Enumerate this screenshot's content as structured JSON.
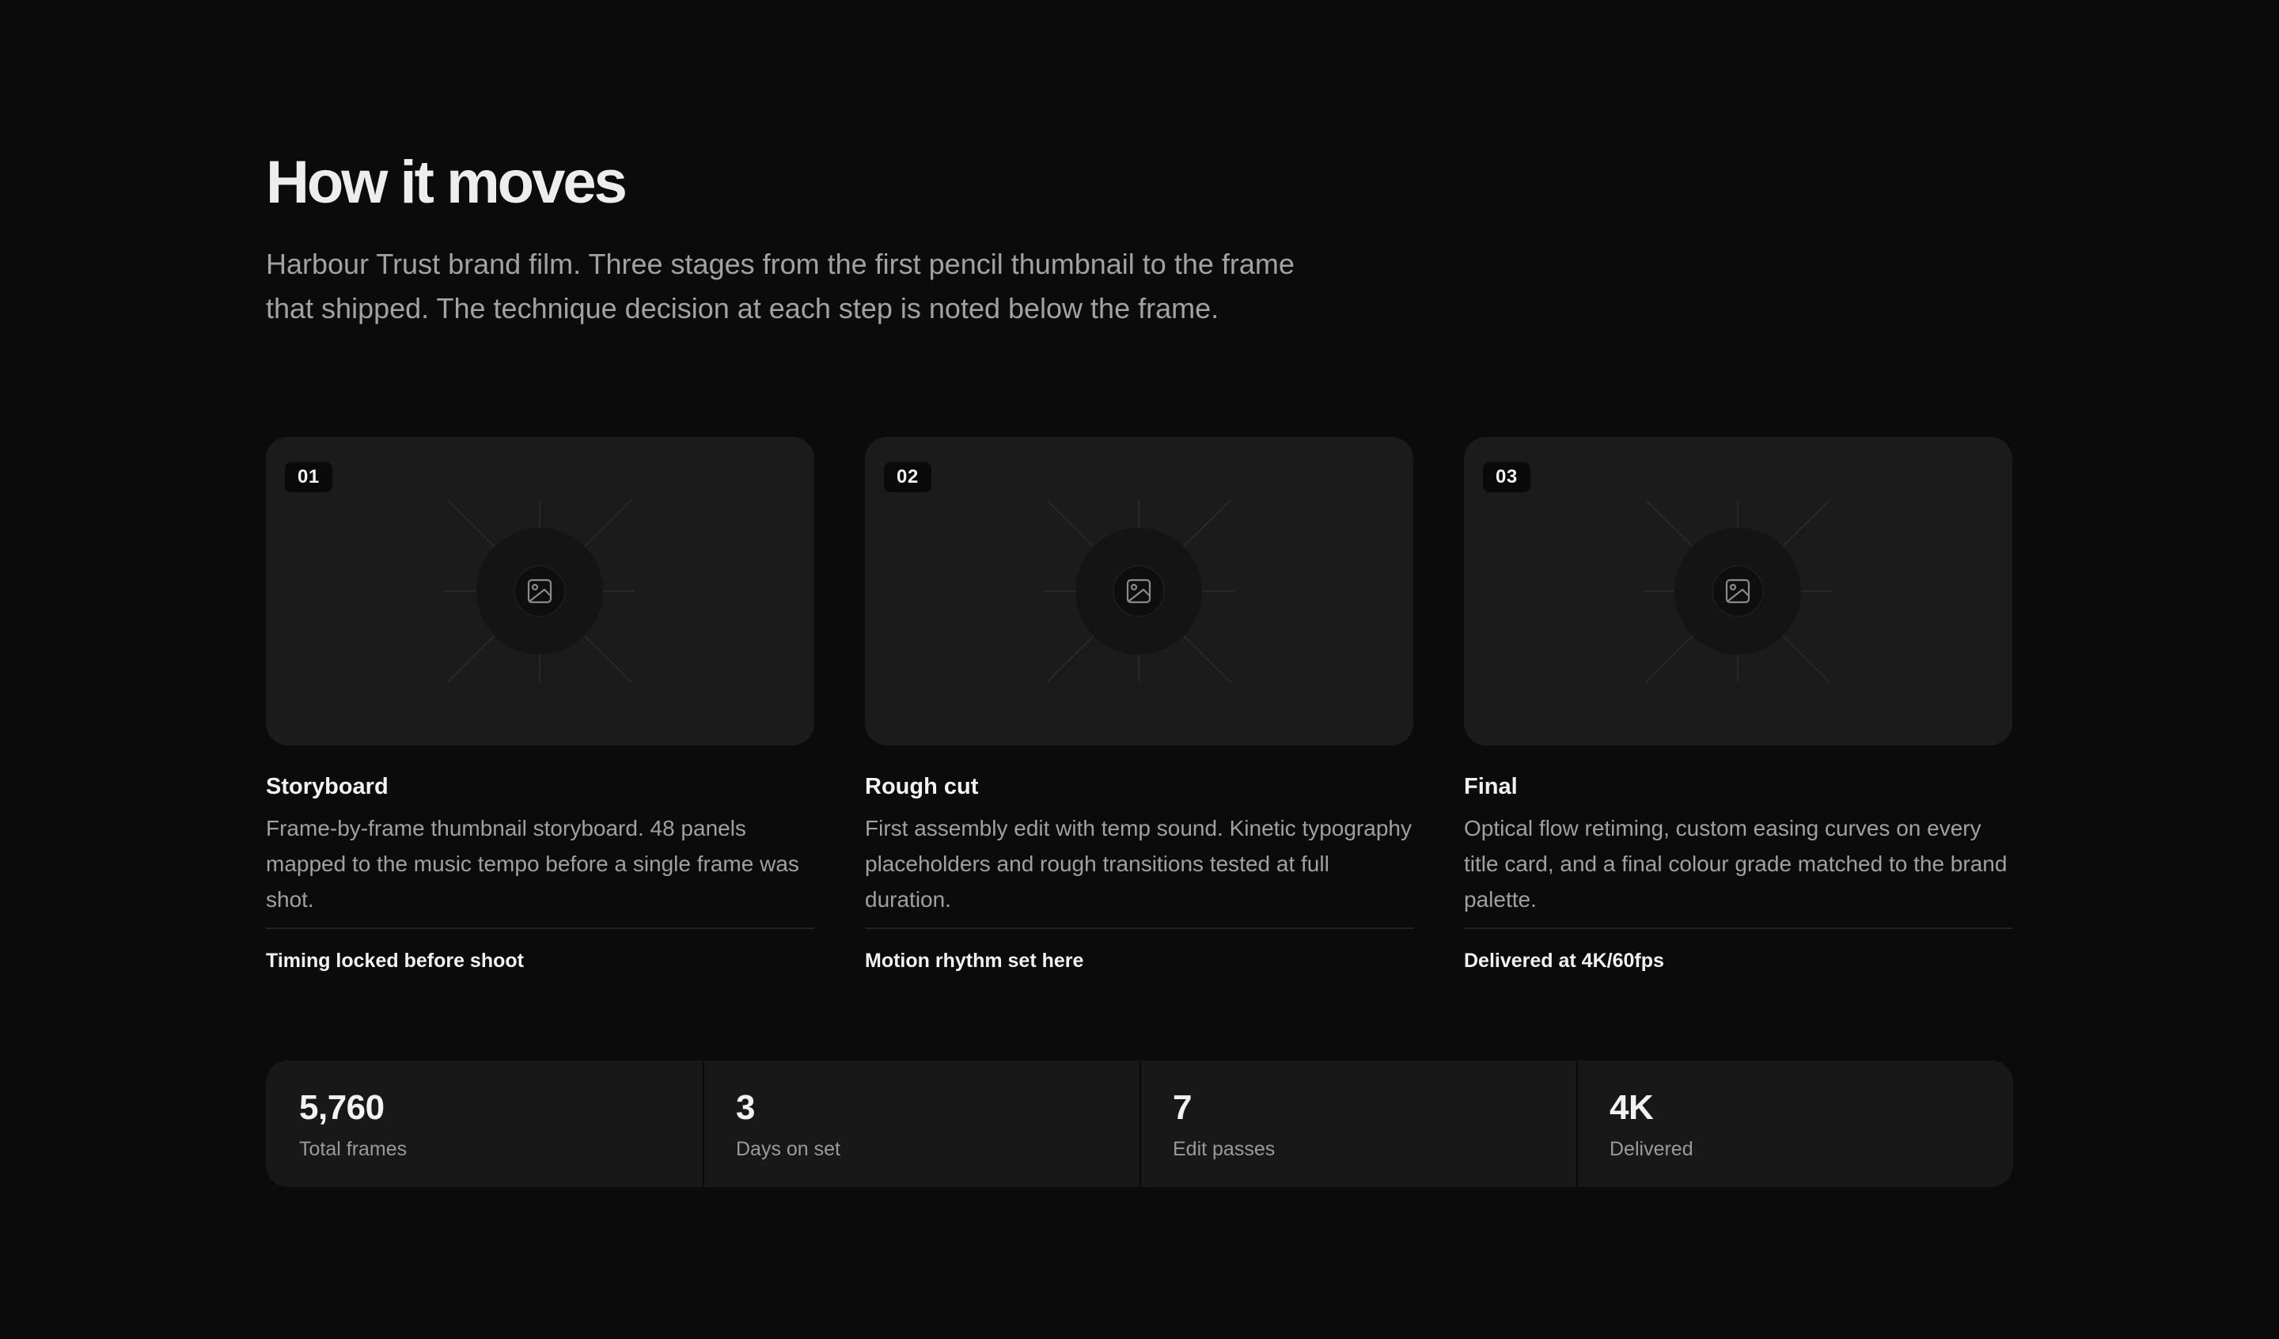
{
  "header": {
    "title": "How it moves",
    "intro": "Harbour Trust brand film. Three stages from the first pencil thumbnail to the frame that shipped. The technique decision at each step is noted below the frame."
  },
  "stages": [
    {
      "number": "01",
      "title": "Storyboard",
      "description": "Frame-by-frame thumbnail storyboard. 48 panels mapped to the music tempo before a single frame was shot.",
      "note": "Timing locked before shoot",
      "icon": "image-icon"
    },
    {
      "number": "02",
      "title": "Rough cut",
      "description": "First assembly edit with temp sound. Kinetic typography placeholders and rough transitions tested at full duration.",
      "note": "Motion rhythm set here",
      "icon": "image-icon"
    },
    {
      "number": "03",
      "title": "Final",
      "description": "Optical flow retiming, custom easing curves on every title card, and a final colour grade matched to the brand palette.",
      "note": "Delivered at 4K/60fps",
      "icon": "image-icon"
    }
  ],
  "stats": [
    {
      "value": "5,760",
      "label": "Total frames"
    },
    {
      "value": "3",
      "label": "Days on set"
    },
    {
      "value": "7",
      "label": "Edit passes"
    },
    {
      "value": "4K",
      "label": "Delivered"
    }
  ],
  "colors": {
    "background": "#0b0b0b",
    "card": "#1b1b1b",
    "badge": "#0a0a0a",
    "text_primary": "#ededed",
    "text_secondary": "#a0a0a0"
  }
}
